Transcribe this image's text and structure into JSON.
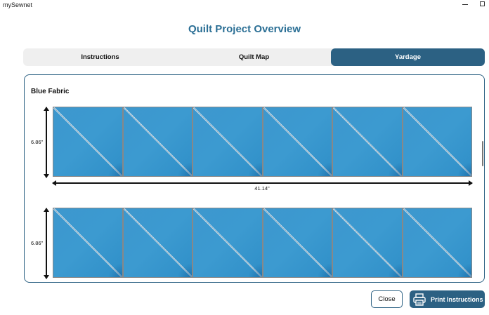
{
  "window": {
    "app_title": "mySewnet"
  },
  "page": {
    "title": "Quilt Project Overview"
  },
  "tabs": [
    {
      "label": "Instructions",
      "active": false
    },
    {
      "label": "Quilt Map",
      "active": false
    },
    {
      "label": "Yardage",
      "active": true
    }
  ],
  "yardage": {
    "section_title": "Blue Fabric",
    "fabric_color": "#3c9ad0",
    "rows": [
      {
        "height_label": "6.86\"",
        "width_label": "41.14\"",
        "blocks": 6
      },
      {
        "height_label": "6.86\"",
        "width_label": "",
        "blocks": 6
      }
    ]
  },
  "footer": {
    "close_label": "Close",
    "print_label": "Print Instructions",
    "print_icon": "printer-icon"
  },
  "colors": {
    "accent": "#2c6183",
    "title": "#2b6f95"
  }
}
